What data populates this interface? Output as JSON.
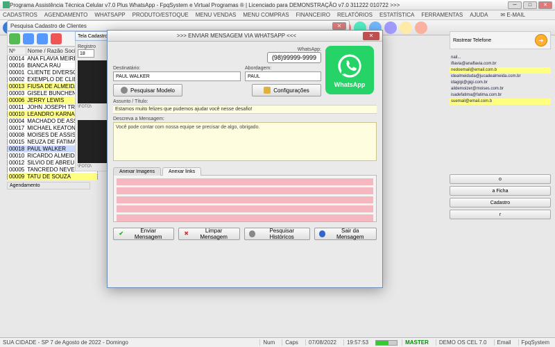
{
  "window": {
    "title": "Programa Assistência Técnica Celular v7.0 Plus WhatsApp - FpqSystem e Virtual Programas ® | Licenciado para  DEMONSTRAÇÃO v7.0 311222 010722 >>>"
  },
  "menu": [
    "CADASTROS",
    "AGENDAMENTO",
    "WHATSAPP",
    "PRODUTO/ESTOQUE",
    "MENU VENDAS",
    "MENU COMPRAS",
    "FINANCEIRO",
    "RELATÓRIOS",
    "ESTATÍSTICA",
    "FERRAMENTAS",
    "AJUDA"
  ],
  "email_menu": "E-MAIL",
  "subwin_search_title": "Pesquisa Cadastro de Clientes",
  "clients": {
    "headers": [
      "Nº",
      "Nome / Razão Social"
    ],
    "rows": [
      {
        "id": "00014",
        "name": "ANA FLAVIA MEIRELLES",
        "hl": ""
      },
      {
        "id": "00016",
        "name": "BIANCA RAU",
        "hl": ""
      },
      {
        "id": "00001",
        "name": "CLIENTE DIVERSOS",
        "hl": ""
      },
      {
        "id": "00002",
        "name": "EXEMPLO DE CLIENTE",
        "hl": ""
      },
      {
        "id": "00013",
        "name": "FIUSA DE ALMEIDA JUCA",
        "hl": "yellow"
      },
      {
        "id": "00003",
        "name": "GISELE BUNCHEN",
        "hl": ""
      },
      {
        "id": "00006",
        "name": "JERRY LEWIS",
        "hl": "yellow"
      },
      {
        "id": "00011",
        "name": "JOHN JOSEPH TRAVOLTA",
        "hl": ""
      },
      {
        "id": "00010",
        "name": "LEANDRO KARNAL",
        "hl": "yellow"
      },
      {
        "id": "00004",
        "name": "MACHADO DE ASSIS",
        "hl": ""
      },
      {
        "id": "00017",
        "name": "MICHAEL KEATON",
        "hl": ""
      },
      {
        "id": "00008",
        "name": "MOISES DE ASSIS",
        "hl": ""
      },
      {
        "id": "00015",
        "name": "NEUZA DE FATIMA DA SI",
        "hl": ""
      },
      {
        "id": "00018",
        "name": "PAUL WALKER",
        "hl": "sel"
      },
      {
        "id": "00010",
        "name": "RICARDO ALMEIDA",
        "hl": ""
      },
      {
        "id": "00012",
        "name": "SILVIO DE ABREU",
        "hl": ""
      },
      {
        "id": "00005",
        "name": "TANCREDO NEVES",
        "hl": ""
      },
      {
        "id": "00009",
        "name": "TATU DE SOUZA",
        "hl": "yellow"
      }
    ],
    "agendamento_label": "Agendamento"
  },
  "tela_cadastro": {
    "title": "Tela Cadastro",
    "registro_label": "Registro",
    "registro_value": "18",
    "foto_label": "\\FOTO\\"
  },
  "right": {
    "rastrear_label": "Rastrear Telefone",
    "emails": [
      {
        "txt": "nail...",
        "hl": ""
      },
      {
        "txt": "iflavia@anaflavia.com.br",
        "hl": ""
      },
      {
        "txt": "nedoemail@email.com.b",
        "hl": "yellow"
      },
      {
        "txt": "idealmeiduda@jucadealmeida.com.br",
        "hl": ""
      },
      {
        "txt": "idagigi@gigi.com.br",
        "hl": ""
      },
      {
        "txt": "aildemoizer@moises.com.br",
        "hl": ""
      },
      {
        "txt": "isadefatima@fatima.com.br",
        "hl": ""
      },
      {
        "txt": "suemail@email.com.b",
        "hl": "yellow"
      }
    ],
    "buttons": [
      "o",
      "a Ficha",
      "Cadastro",
      "r"
    ]
  },
  "modal": {
    "title": ">>> ENVIAR MENSAGEM VIA WHATSAPP  <<<",
    "whatsapp_label": "WhatsApp:",
    "whatsapp_number": "(98)99999-9999",
    "whatsapp_logo_text": "WhatsApp",
    "destinatario_label": "Destinatário:",
    "destinatario_value": "PAUL WALKER",
    "abordagem_label": "Abordagem:",
    "abordagem_value": "PAUL",
    "btn_pesquisar_modelo": "Pesquisar Modelo",
    "btn_config": "Configurações",
    "assunto_label": "Assunto / Título:",
    "assunto_value": "Estamos muito felizes que pudemos ajudar você nesse desafio!",
    "descreva_label": "Descreva a Mensagem:",
    "descreva_value": "Você pode contar com nossa equipe se precisar de algo, obrigado.",
    "tabs": [
      "Anexar Imagens",
      "Anexar links"
    ],
    "footer": {
      "enviar": "Enviar Mensagem",
      "limpar": "Limpar Mensagem",
      "hist": "Pesquisar Históricos",
      "sair": "Sair da Mensagem"
    }
  },
  "status": {
    "left": "SUA CIDADE - SP  7 de Agosto de 2022 - Domingo",
    "num": "Num",
    "caps": "Caps",
    "date": "07/08/2022",
    "time": "19:57:53",
    "master": "MASTER",
    "demo": "DEMO OS CEL 7.0",
    "email": "Email",
    "fpq": "FpqSystem"
  },
  "icon_colors": [
    "#3a7bd5",
    "#00b894",
    "#e67e22",
    "#9b59b6",
    "#e74c3c",
    "#1abc9c",
    "#f1c40f",
    "#2ecc71",
    "#3498db",
    "#e84393",
    "#fd79a8",
    "#00cec9",
    "#6c5ce7",
    "#d35400",
    "#27ae60",
    "#2980b9",
    "#8e44ad",
    "#c0392b",
    "#16a085",
    "#f39c12",
    "#7f8c8d",
    "#2c3e50",
    "#ff7675",
    "#55efc4",
    "#74b9ff",
    "#a29bfe",
    "#ffeaa7",
    "#fab1a0"
  ]
}
